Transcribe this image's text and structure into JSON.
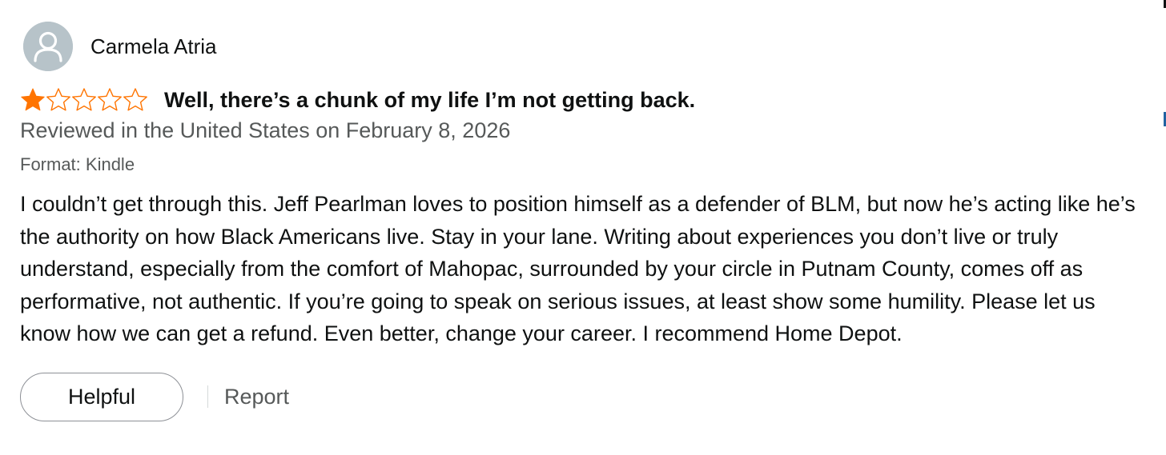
{
  "reviewer": {
    "name": "Carmela Atria",
    "avatar_icon": "default-user-silhouette-icon"
  },
  "rating": {
    "value": 1,
    "max": 5,
    "filled_color": "#ff7400",
    "empty_color": "#ff7400"
  },
  "review": {
    "title": "Well, there’s a chunk of my life I’m not getting back.",
    "date": "Reviewed in the United States on February 8, 2026",
    "format": "Format: Kindle",
    "body": "I couldn’t get through this. Jeff Pearlman loves to position himself as a defender of BLM, but now he’s acting like he’s the authority on how Black Americans live. Stay in your lane. Writing about experiences you don’t live or truly understand, especially from the comfort of Mahopac, surrounded by your circle in Putnam County, comes off as performative, not authentic. If you’re going to speak on serious issues, at least show some humility. Please let us know how we can get a refund. Even better, change your career. I recommend Home Depot."
  },
  "actions": {
    "helpful_label": "Helpful",
    "report_label": "Report"
  }
}
